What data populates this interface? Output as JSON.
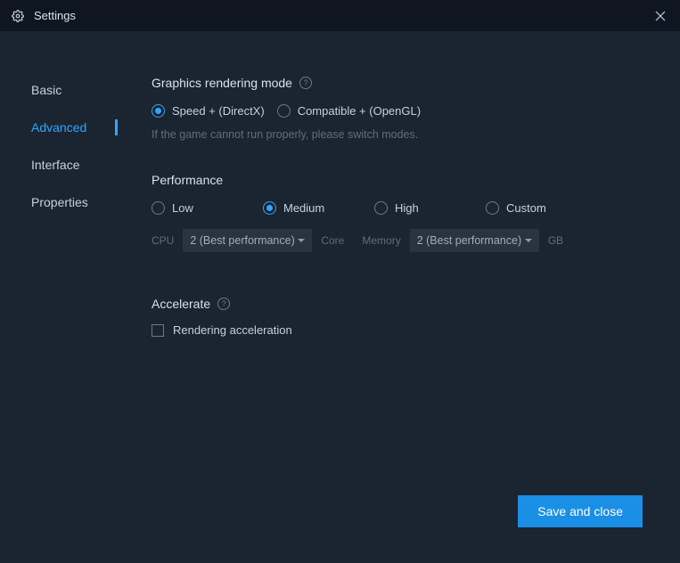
{
  "titlebar": {
    "title": "Settings"
  },
  "sidebar": {
    "items": [
      {
        "label": "Basic"
      },
      {
        "label": "Advanced"
      },
      {
        "label": "Interface"
      },
      {
        "label": "Properties"
      }
    ]
  },
  "graphics": {
    "title": "Graphics rendering mode",
    "options": [
      {
        "label": "Speed + (DirectX)"
      },
      {
        "label": "Compatible + (OpenGL)"
      }
    ],
    "hint": "If the game cannot run properly, please switch modes."
  },
  "performance": {
    "title": "Performance",
    "options": [
      {
        "label": "Low"
      },
      {
        "label": "Medium"
      },
      {
        "label": "High"
      },
      {
        "label": "Custom"
      }
    ],
    "cpu_label": "CPU",
    "cpu_value": "2 (Best performance)",
    "core_label": "Core",
    "memory_label": "Memory",
    "memory_value": "2 (Best performance)",
    "gb_label": "GB"
  },
  "accelerate": {
    "title": "Accelerate",
    "checkbox_label": "Rendering acceleration"
  },
  "footer": {
    "save_label": "Save and close"
  }
}
